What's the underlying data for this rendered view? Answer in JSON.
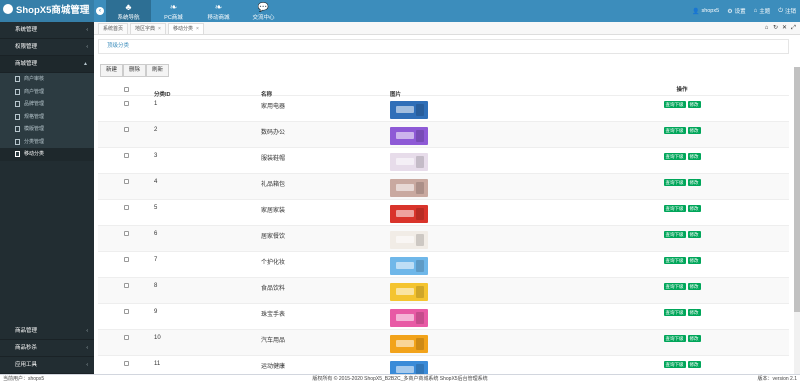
{
  "app": {
    "title": "ShopX5商城管理"
  },
  "topnav": [
    {
      "label": "系统导航",
      "icon": "tree-icon"
    },
    {
      "label": "PC商城",
      "icon": "leaf-icon"
    },
    {
      "label": "移动商城",
      "icon": "leaf-icon"
    },
    {
      "label": "交流中心",
      "icon": "chat-icon"
    }
  ],
  "header_right": {
    "user": "shopx5",
    "settings": "设置",
    "theme": "主题",
    "logout": "注销"
  },
  "sidebar": {
    "groups_top": [
      "系统管理",
      "权限管理"
    ],
    "open_group": "商城管理",
    "items": [
      "商户审核",
      "商户管理",
      "品牌管理",
      "规格管理",
      "模版管理",
      "分类管理",
      "移动分类"
    ],
    "active_item": "移动分类",
    "groups_bottom": [
      "商品管理",
      "商品秒杀",
      "应用工具"
    ]
  },
  "tabs": [
    {
      "label": "系统首页",
      "closable": false
    },
    {
      "label": "地区字典",
      "closable": true
    },
    {
      "label": "移动分类",
      "closable": true
    }
  ],
  "breadcrumb": "顶级分类",
  "toolbar": {
    "new": "新建",
    "delete": "删除",
    "refresh": "刷新"
  },
  "table": {
    "headers": {
      "id": "分类ID",
      "name": "名称",
      "image": "图片",
      "ops": "操作"
    },
    "op_view": "查询下级",
    "op_edit": "修改",
    "rows": [
      {
        "id": "1",
        "name": "家用电器"
      },
      {
        "id": "2",
        "name": "数码办公"
      },
      {
        "id": "3",
        "name": "服装鞋帽"
      },
      {
        "id": "4",
        "name": "礼品箱包"
      },
      {
        "id": "5",
        "name": "家居家装"
      },
      {
        "id": "6",
        "name": "居家餐饮"
      },
      {
        "id": "7",
        "name": "个护化妆"
      },
      {
        "id": "8",
        "name": "食品饮料"
      },
      {
        "id": "9",
        "name": "珠宝手表"
      },
      {
        "id": "10",
        "name": "汽车用品"
      },
      {
        "id": "11",
        "name": "运动健康"
      }
    ]
  },
  "thumb_colors": [
    "#2f6fb8",
    "#8e5ad6",
    "#e7dcea",
    "#c9a9a0",
    "#d9342b",
    "#f1ece6",
    "#6fb7e9",
    "#f4c430",
    "#e85aa5",
    "#f2a31b",
    "#3a8bd8"
  ],
  "colors": {
    "header": "#3c8dbc",
    "sidebar": "#222d32",
    "op_button": "#00a65a"
  },
  "footer": {
    "left": "当前用户：shopx5",
    "center": "版权所有 © 2015-2020 ShopX5_B2B2C_多商户商城系统 ShopX5后台管理系统",
    "right": "版本：version 2.1"
  }
}
